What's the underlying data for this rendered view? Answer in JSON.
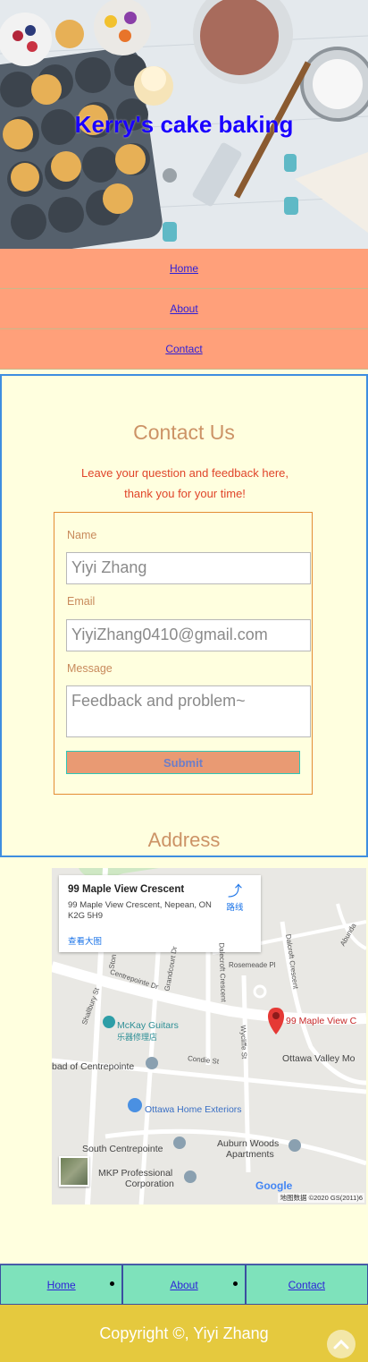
{
  "header": {
    "title": "Kerry's cake baking"
  },
  "nav": [
    {
      "label": "Home"
    },
    {
      "label": "About"
    },
    {
      "label": "Contact"
    }
  ],
  "contact": {
    "title": "Contact Us",
    "subtitle_line1": "Leave your question and feedback here,",
    "subtitle_line2": "thank you for your time!",
    "name_label": "Name",
    "name_value": "Yiyi Zhang",
    "email_label": "Email",
    "email_value": "YiyiZhang0410@gmail.com",
    "message_label": "Message",
    "message_placeholder": "Feedback and problem~",
    "submit_label": "Submit",
    "address_title": "Address"
  },
  "map": {
    "card_title": "99 Maple View Crescent",
    "card_address": "99 Maple View Crescent, Nepean, ON K2G 5H9",
    "card_link": "查看大图",
    "route_label": "路线",
    "pin_label": "99 Maple View C",
    "places": {
      "mckay": "McKay Guitars",
      "mckay_sub": "乐器修理店",
      "centrepointe": "bad of Centrepointe",
      "ottawa_valley": "Ottawa Valley Mo",
      "ottawa_home": "Ottawa Home Exteriors",
      "south_centrepointe": "South Centrepointe",
      "auburn": "Auburn Woods",
      "auburn_sub": "Apartments",
      "mkp": "MKP Professional",
      "mkp_sub": "Corporation"
    },
    "streets": {
      "centrepointe_dr": "Centrepointe Dr",
      "rosemeade": "Rosemeade Pl",
      "condie": "Condie St",
      "stonehaven": "Ston",
      "grandcourt": "Grandcourt Dr",
      "dalecroft": "Dalecroft Crescent",
      "wycliffe": "Wycliffe St",
      "shallbury": "Shallbury St",
      "delcroft": "Dalcroft Crescent",
      "abundance": "Abunda"
    },
    "google": "Google",
    "credit": "地图数据 ©2020 GS(2011)6"
  },
  "footer_nav": [
    {
      "label": "Home"
    },
    {
      "label": "About"
    },
    {
      "label": "Contact"
    }
  ],
  "footer": {
    "copyright": "Copyright ©, Yiyi Zhang"
  },
  "colors": {
    "nav_bg": "#ffa07a",
    "page_bg": "#ffffdf",
    "footer_bg": "#e5c93e",
    "footer_nav_bg": "#7ee2bb",
    "accent_title": "#cc9366"
  }
}
